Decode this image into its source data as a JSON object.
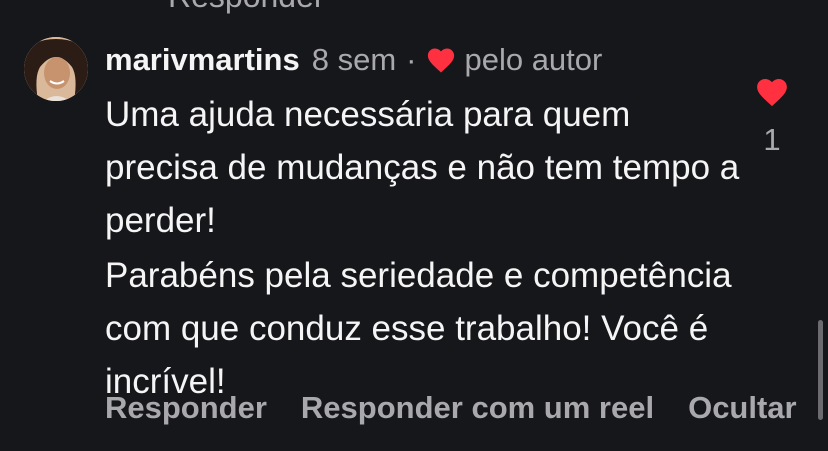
{
  "previous": {
    "reply_label": "Responder"
  },
  "comment": {
    "username": "marivmartins",
    "age": "8 sem",
    "separator": "·",
    "author_like_label": "pelo autor",
    "paragraphs": [
      "Uma ajuda necessária para quem precisa de mudanças e não tem tempo a perder!",
      "Parabéns pela seriedade e competência com que conduz esse trabalho! Você é incrível!"
    ],
    "like_count": "1",
    "actions": {
      "reply": "Responder",
      "reply_reel": "Responder com um reel",
      "hide": "Ocultar"
    }
  },
  "colors": {
    "background": "#16171b",
    "heart": "#ff3040",
    "muted_text": "#a8a8ad",
    "primary_text": "#f5f5f5"
  },
  "icons": {
    "author_like": "heart-filled-icon",
    "like": "heart-filled-icon",
    "avatar": "avatar"
  }
}
